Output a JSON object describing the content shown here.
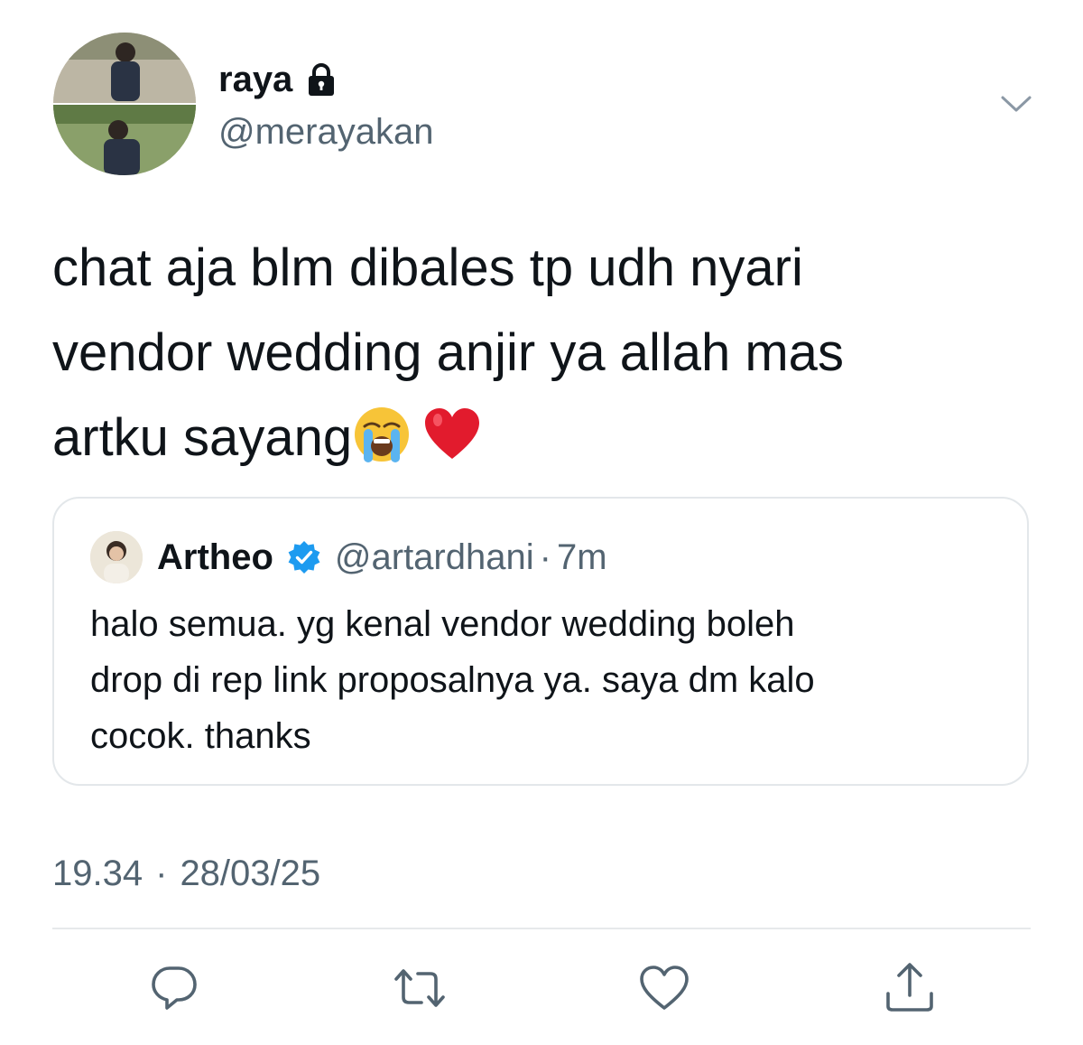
{
  "tweet": {
    "author": {
      "display_name": "raya",
      "handle": "@merayakan",
      "protected_icon": "lock-icon",
      "avatar_icon": "avatar-photo"
    },
    "text_lines": [
      "chat aja blm dibales tp udh nyari",
      "vendor wedding anjir ya allah mas",
      "artku sayang"
    ],
    "emojis": [
      "loudly-crying-face",
      "red-heart"
    ],
    "timestamp": {
      "time": "19.34",
      "separator": "·",
      "date": "28/03/25"
    },
    "more_icon": "chevron-down-icon"
  },
  "quoted_tweet": {
    "display_name": "Artheo",
    "verified_icon": "verified-badge-icon",
    "handle": "@artardhani",
    "separator": "·",
    "time_ago": "7m",
    "text_lines": [
      "halo semua. yg kenal vendor wedding boleh",
      "drop di rep link proposalnya ya. saya dm kalo",
      "cocok. thanks"
    ]
  },
  "actions": [
    {
      "name": "reply",
      "icon": "reply-icon"
    },
    {
      "name": "retweet",
      "icon": "retweet-icon"
    },
    {
      "name": "like",
      "icon": "heart-icon"
    },
    {
      "name": "share",
      "icon": "share-icon"
    }
  ],
  "colors": {
    "primary_text": "#0f1419",
    "secondary_text": "#536471",
    "border": "#e3e7ea",
    "verified_blue": "#1d9bf0",
    "icon_gray": "#536471"
  }
}
